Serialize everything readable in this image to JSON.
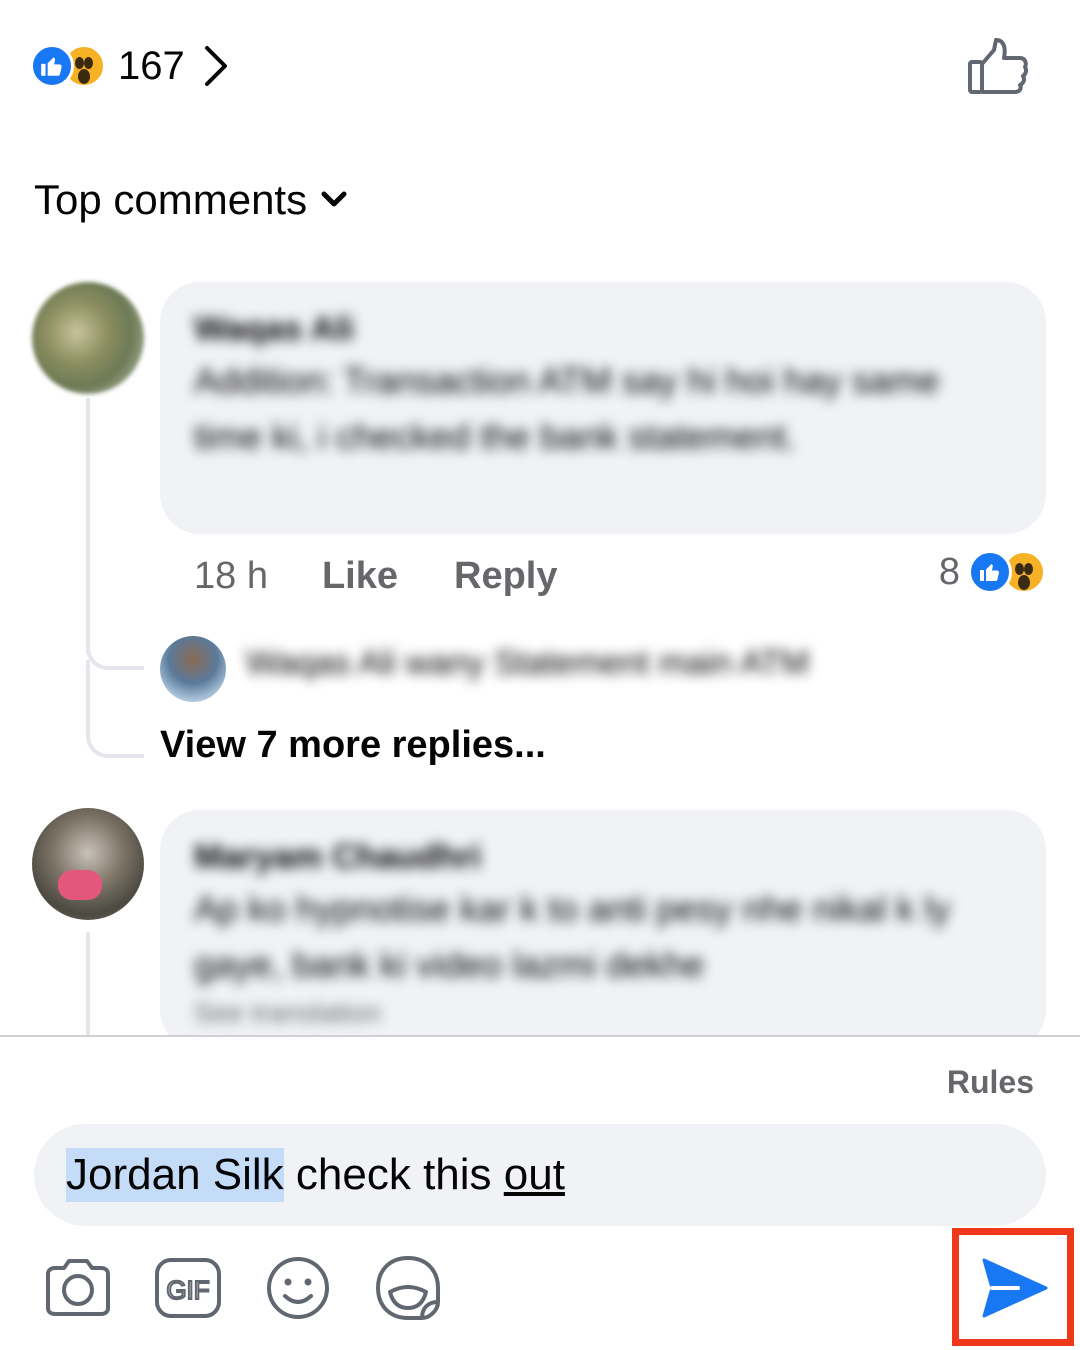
{
  "post_reactions": {
    "icons": [
      "like-icon",
      "wow-icon"
    ],
    "count": "167"
  },
  "sort": {
    "label": "Top comments"
  },
  "comments": [
    {
      "author": "Waqas Ali",
      "body": "Addition: Transaction ATM say hi hoi hay same time ki, i checked the bank statement.",
      "time": "18 h",
      "like_label": "Like",
      "reply_label": "Reply",
      "reaction_count": "8",
      "reply_preview": "Waqas Ali wany Statement main ATM",
      "view_more_label": "View 7 more replies..."
    },
    {
      "author": "Maryam Chaudhri",
      "body": "Ap ko hypnotise kar k to anti pesy nhe nikal k ly gaye, bank ki video lazmi dekhe",
      "see_translation": "See translation"
    }
  ],
  "composer": {
    "rules_label": "Rules",
    "mention": "Jordan Silk",
    "text_plain": " check this ",
    "text_link": "out",
    "tools": [
      "camera-icon",
      "gif-icon",
      "emoji-icon",
      "sticker-icon"
    ]
  },
  "colors": {
    "accent": "#1877f2",
    "highlight_box": "#f0381a",
    "bubble": "#f0f2f5",
    "muted_text": "#65676b"
  }
}
